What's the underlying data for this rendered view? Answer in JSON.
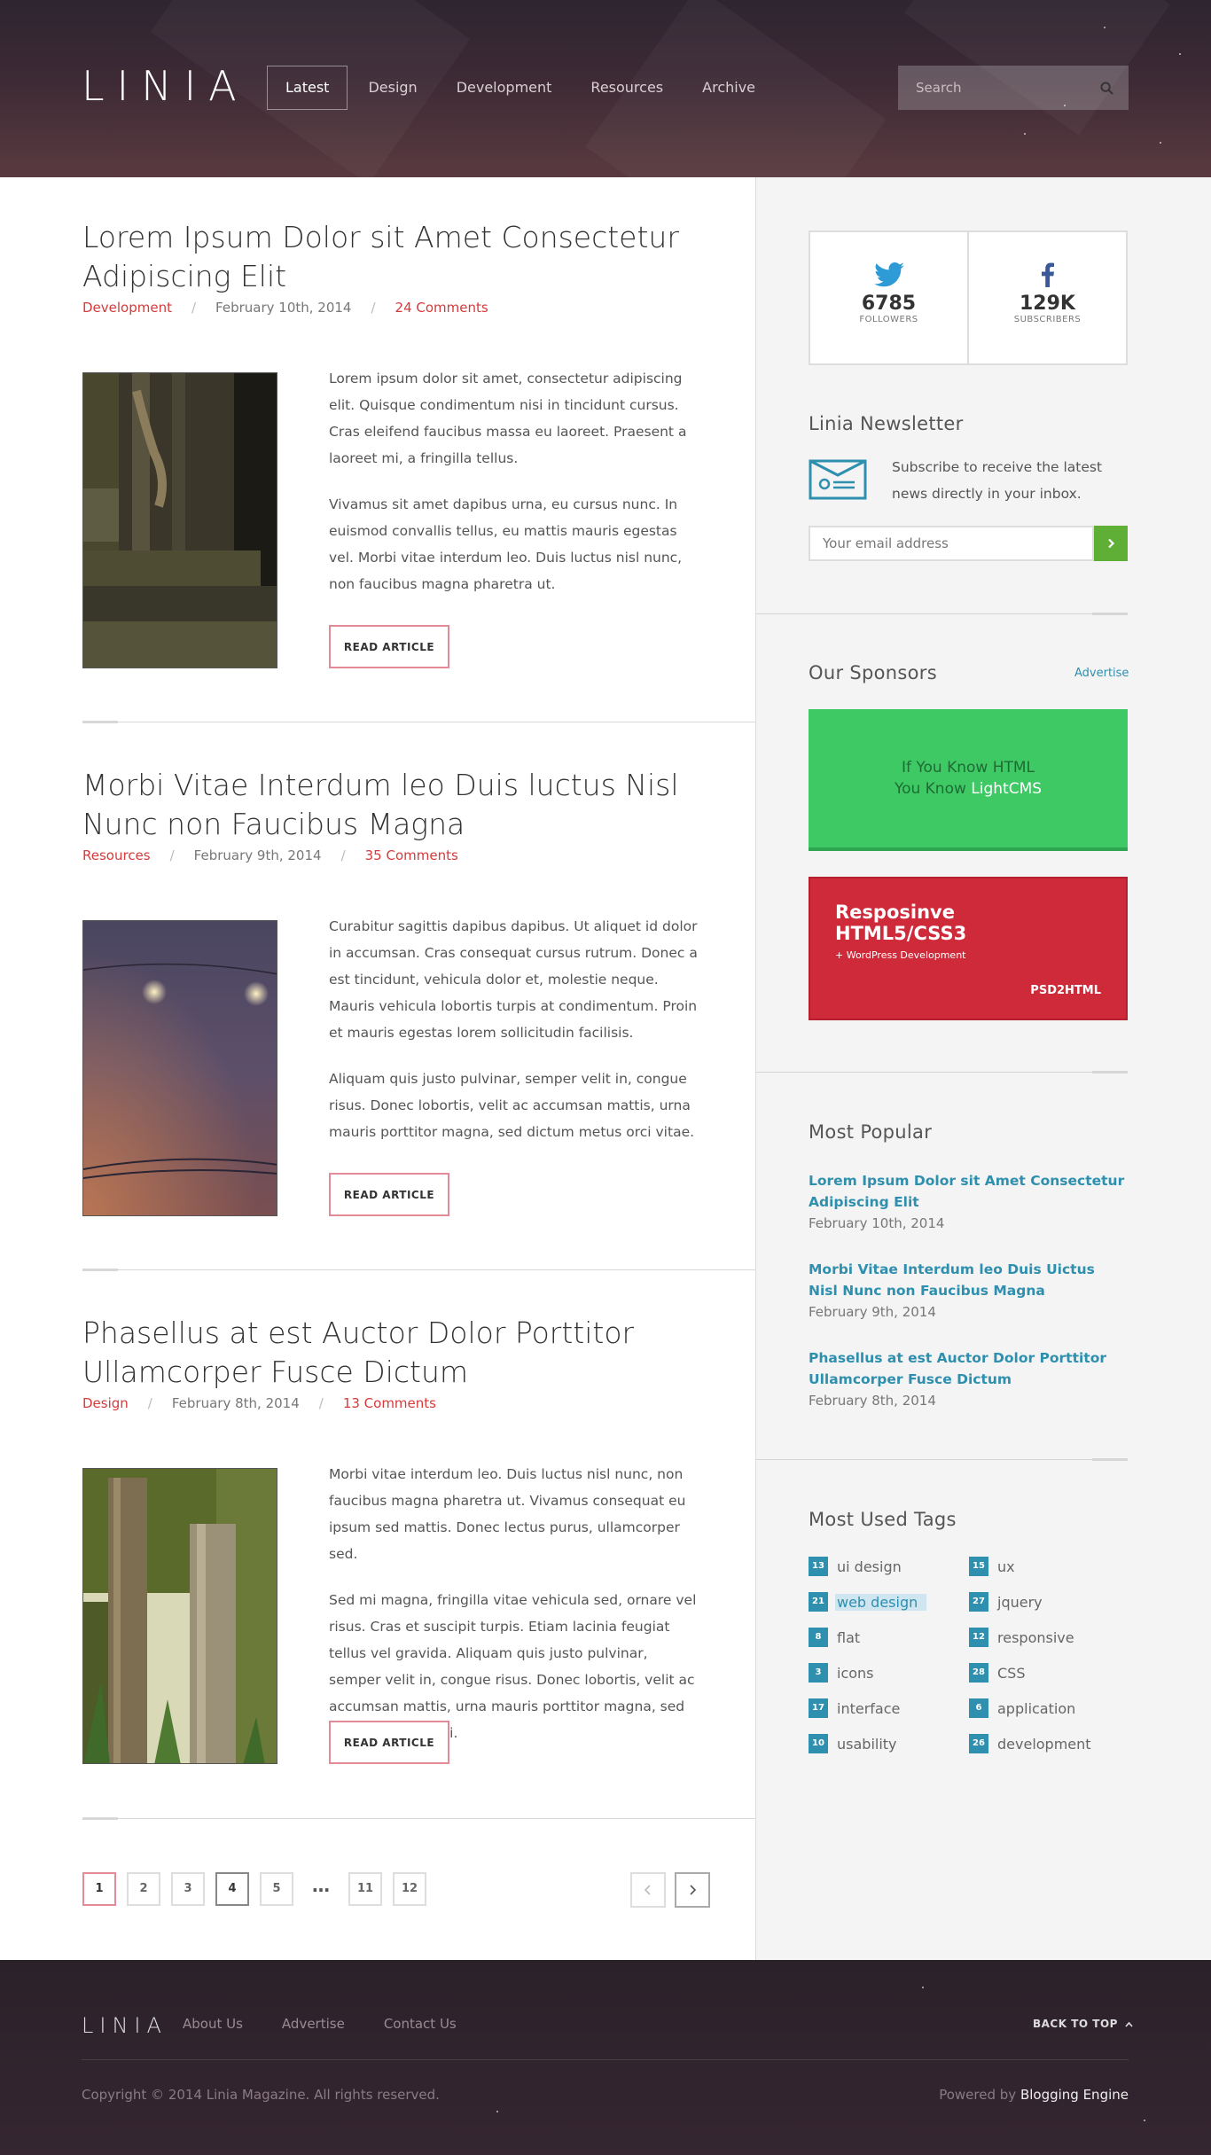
{
  "brand": {
    "logo": "LINIA"
  },
  "nav": {
    "items": [
      {
        "label": "Latest"
      },
      {
        "label": "Design"
      },
      {
        "label": "Development"
      },
      {
        "label": "Resources"
      },
      {
        "label": "Archive"
      }
    ],
    "active_index": 0
  },
  "search": {
    "placeholder": "Search",
    "icon": "search-icon"
  },
  "posts": [
    {
      "title": "Lorem Ipsum Dolor sit Amet Consectetur Adipiscing Elit",
      "category": "Development",
      "date": "February 10th, 2014",
      "comments": "24 Comments",
      "paragraphs": [
        "Lorem ipsum dolor sit amet, consectetur adipiscing elit. Quisque condimentum nisi in tincidunt cursus. Cras eleifend faucibus massa eu laoreet. Praesent a laoreet mi, a fringilla tellus.",
        "Vivamus sit amet dapibus urna, eu cursus nunc. In euismod convallis tellus, eu mattis mauris egestas vel. Morbi vitae interdum leo. Duis luctus nisl nunc, non faucibus magna pharetra ut."
      ],
      "button": "READ ARTICLE"
    },
    {
      "title": "Morbi Vitae Interdum leo Duis luctus Nisl Nunc non Faucibus Magna",
      "category": "Resources",
      "date": "February 9th, 2014",
      "comments": "35 Comments",
      "paragraphs": [
        "Curabitur sagittis dapibus dapibus. Ut aliquet id dolor in accumsan. Cras consequat cursus rutrum. Donec a est tincidunt, vehicula dolor et, molestie neque. Mauris vehicula lobortis turpis at condimentum. Proin et mauris egestas lorem sollicitudin facilisis.",
        "Aliquam quis justo pulvinar, semper velit in, congue risus. Donec lobortis, velit ac accumsan mattis, urna mauris porttitor magna, sed dictum metus orci vitae."
      ],
      "button": "READ ARTICLE"
    },
    {
      "title": "Phasellus at est Auctor Dolor Porttitor Ullamcorper Fusce Dictum",
      "category": "Design",
      "date": "February 8th, 2014",
      "comments": "13 Comments",
      "paragraphs": [
        "Morbi vitae interdum leo. Duis luctus nisl nunc, non faucibus magna pharetra ut. Vivamus consequat eu ipsum sed mattis. Donec lectus purus, ullamcorper sed.",
        "Sed mi magna, fringilla vitae vehicula sed, ornare vel risus. Cras et suscipit turpis. Etiam lacinia feugiat tellus vel gravida. Aliquam quis justo pulvinar, semper velit in, congue risus. Donec lobortis, velit ac accumsan mattis, urna mauris porttitor magna, sed dictum metus orci."
      ],
      "button": "READ ARTICLE"
    }
  ],
  "pagination": {
    "pages": [
      "1",
      "2",
      "3",
      "4",
      "5",
      "…",
      "11",
      "12"
    ],
    "current": "1"
  },
  "social": {
    "twitter": {
      "count": "6785",
      "label": "FOLLOWERS",
      "icon": "twitter-icon"
    },
    "facebook": {
      "count": "129K",
      "label": "SUBSCRIBERS",
      "icon": "facebook-icon"
    }
  },
  "newsletter": {
    "title": "Linia Newsletter",
    "text": "Subscribe to  receive the latest news directly in your inbox.",
    "placeholder": "Your email address",
    "icon": "newsletter-icon"
  },
  "sponsors": {
    "title": "Our Sponsors",
    "advertise": "Advertise",
    "ad1": {
      "line1": "If You Know HTML",
      "line2_prefix": "You Know ",
      "line2_highlight": "LightCMS",
      "color": "#3ec965"
    },
    "ad2": {
      "title_line1": "Resposinve",
      "title_line2": "HTML5/CSS3",
      "subtitle": "+ WordPress Development",
      "brand": "PSD2HTML",
      "color": "#cf2a3a"
    }
  },
  "popular": {
    "title": "Most Popular",
    "items": [
      {
        "title": "Lorem Ipsum Dolor sit Amet Consectetur Adipiscing Elit",
        "date": "February 10th, 2014"
      },
      {
        "title": "Morbi Vitae Interdum leo Duis Uictus Nisl Nunc non Faucibus Magna",
        "date": "February 9th, 2014"
      },
      {
        "title": "Phasellus at est Auctor Dolor Porttitor Ullamcorper Fusce Dictum",
        "date": "February 8th, 2014"
      }
    ]
  },
  "tags": {
    "title": "Most Used Tags",
    "left": [
      {
        "count": "13",
        "name": "ui design"
      },
      {
        "count": "21",
        "name": "web design"
      },
      {
        "count": "8",
        "name": "flat"
      },
      {
        "count": "3",
        "name": "icons"
      },
      {
        "count": "17",
        "name": "interface"
      },
      {
        "count": "10",
        "name": "usability"
      }
    ],
    "right": [
      {
        "count": "15",
        "name": "ux"
      },
      {
        "count": "27",
        "name": "jquery"
      },
      {
        "count": "12",
        "name": "responsive"
      },
      {
        "count": "28",
        "name": "CSS"
      },
      {
        "count": "6",
        "name": "application"
      },
      {
        "count": "26",
        "name": "development"
      }
    ],
    "highlighted": "web design"
  },
  "footer": {
    "logo": "LINIA",
    "links": [
      "About Us",
      "Advertise",
      "Contact Us"
    ],
    "back_to_top": "BACK TO TOP",
    "copyright": "Copyright © 2014 Linia Magazine. All rights reserved.",
    "powered_prefix": "Powered by ",
    "powered_link": "Blogging Engine"
  },
  "colors": {
    "accent_red": "#d63a3a",
    "link_blue": "#2e8fae",
    "button_green": "#5fae35"
  }
}
